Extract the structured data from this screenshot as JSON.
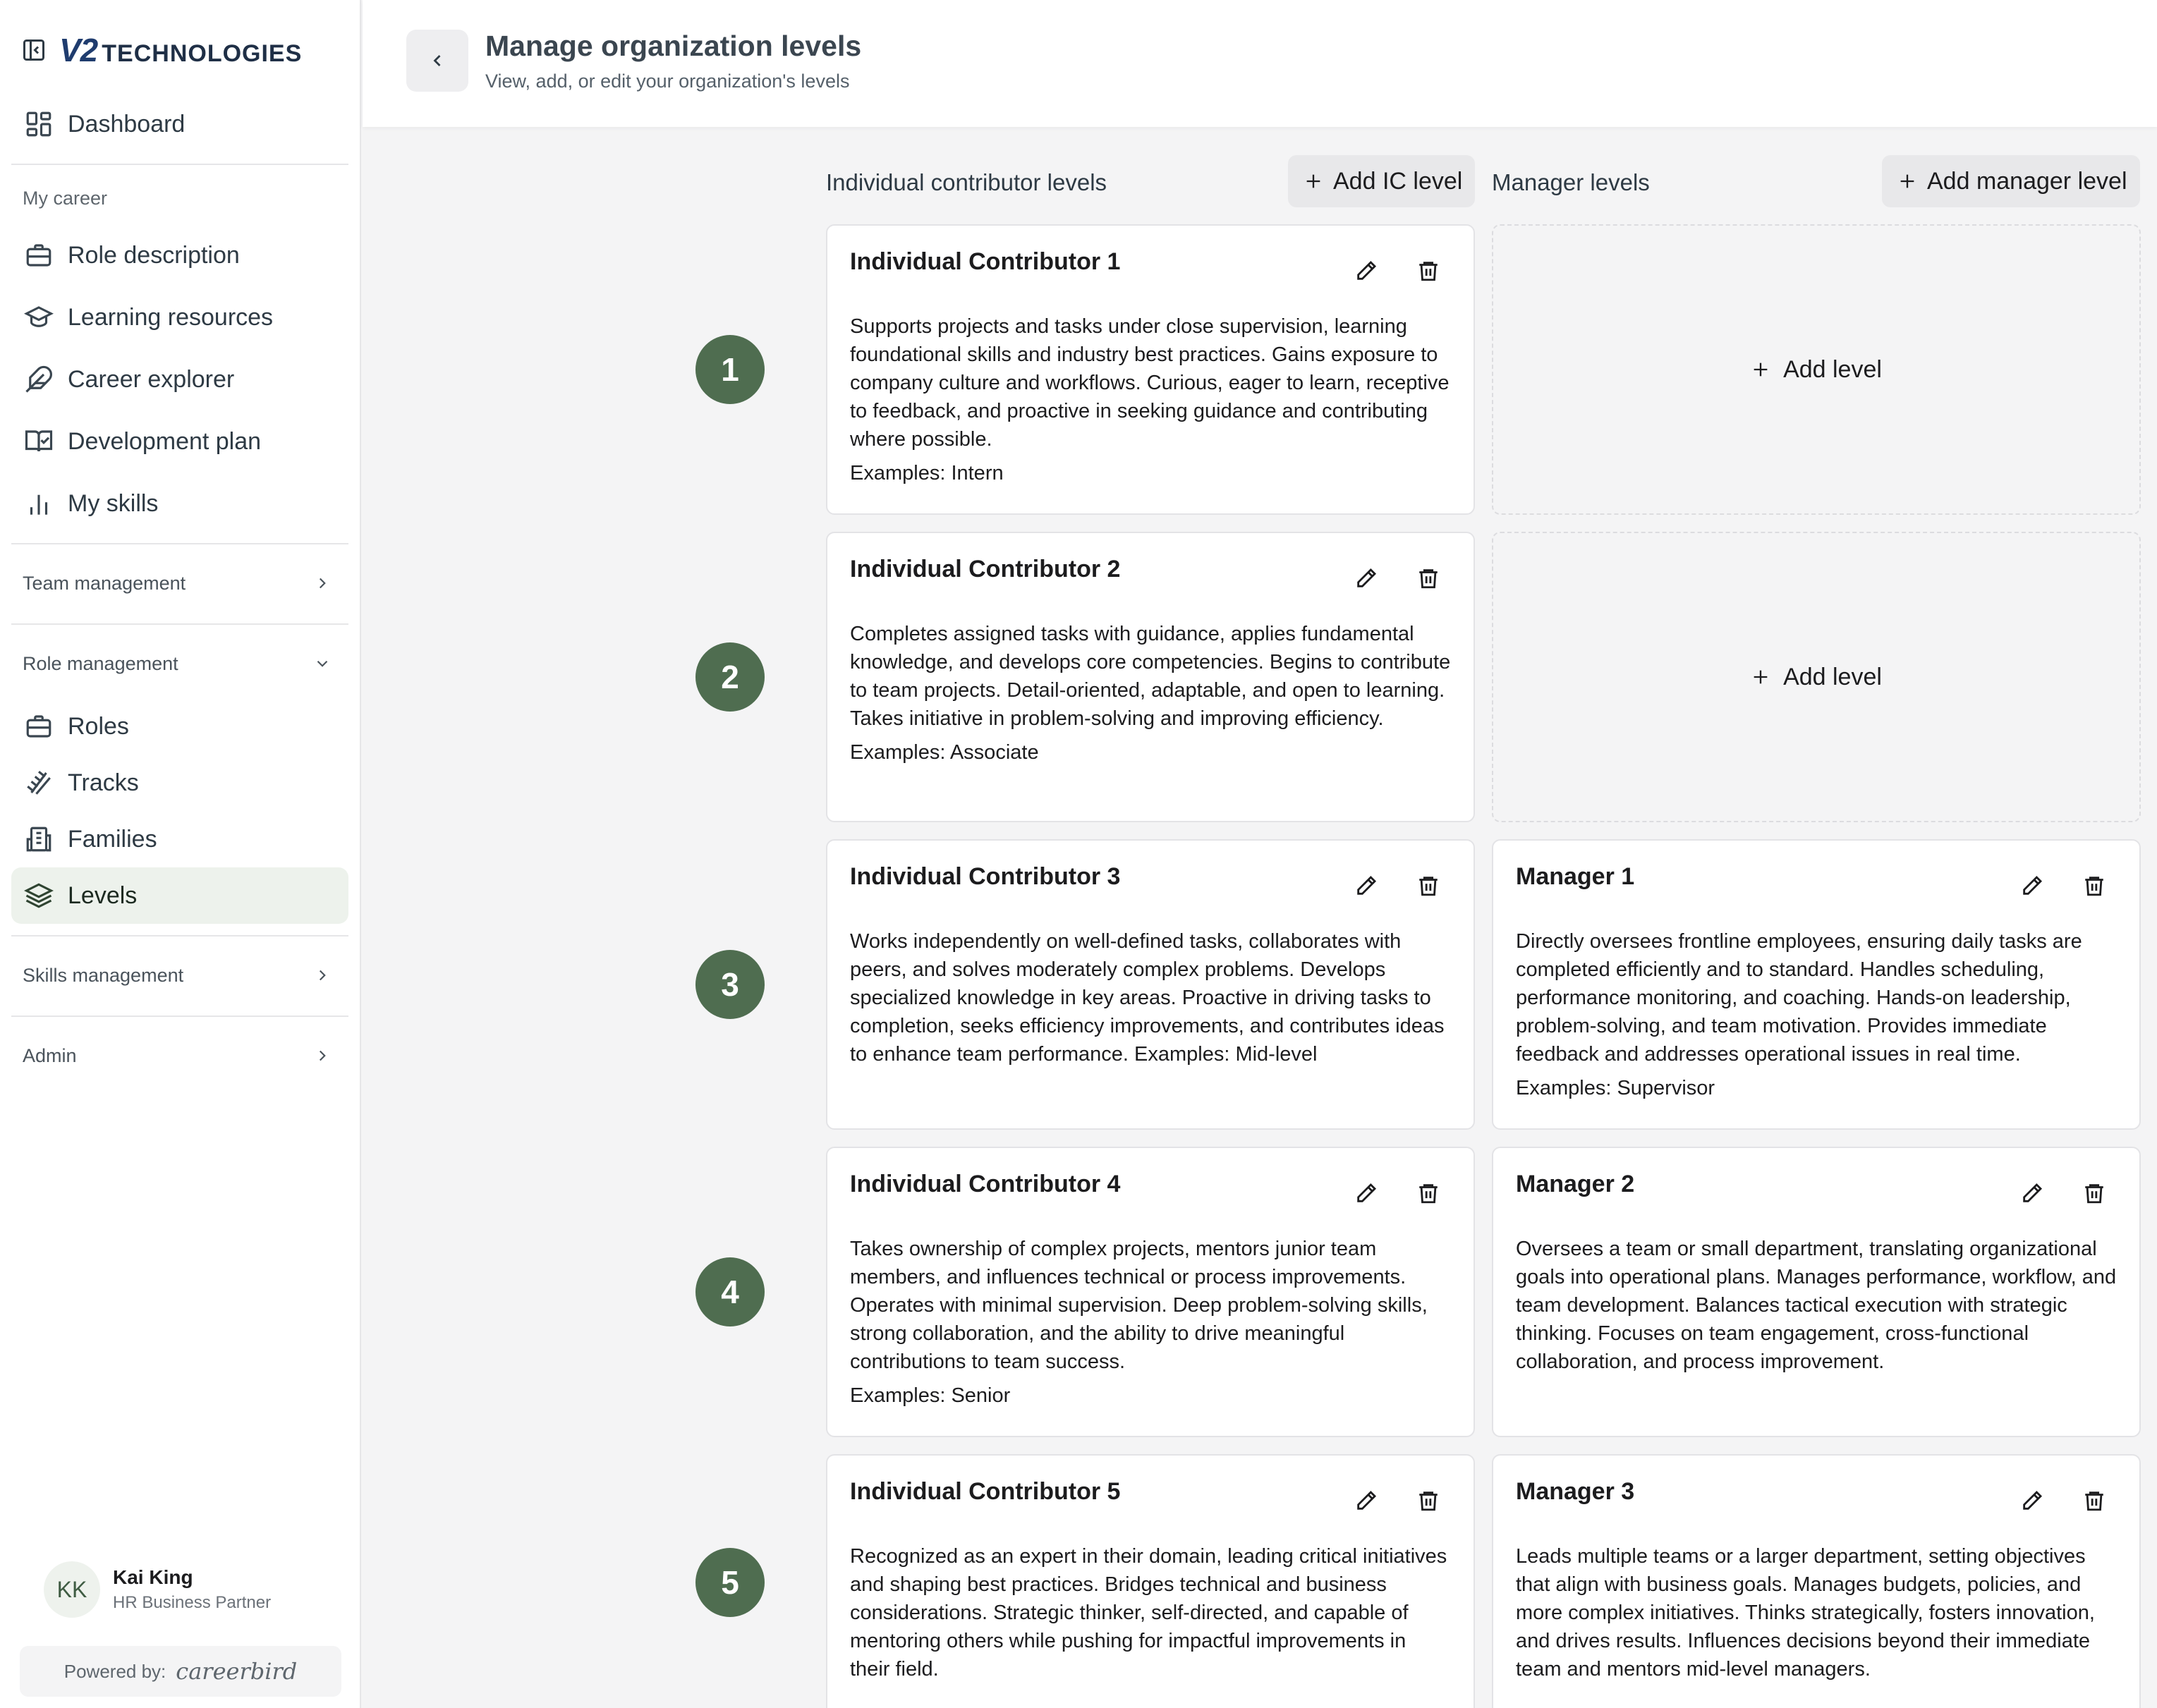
{
  "brand": {
    "name": "TECHNOLOGIES",
    "mark": "V2"
  },
  "sidebar": {
    "dashboard": "Dashboard",
    "my_career_label": "My career",
    "my_career": [
      {
        "label": "Role description",
        "icon": "briefcase-icon"
      },
      {
        "label": "Learning resources",
        "icon": "graduation-cap-icon"
      },
      {
        "label": "Career explorer",
        "icon": "feather-icon"
      },
      {
        "label": "Development plan",
        "icon": "book-check-icon"
      },
      {
        "label": "My skills",
        "icon": "bar-chart-icon"
      }
    ],
    "team_management": "Team management",
    "role_management": "Role management",
    "role_items": [
      {
        "label": "Roles",
        "icon": "briefcase-icon"
      },
      {
        "label": "Tracks",
        "icon": "railway-track-icon"
      },
      {
        "label": "Families",
        "icon": "building-icon"
      },
      {
        "label": "Levels",
        "icon": "layers-icon",
        "active": true
      }
    ],
    "skills_management": "Skills management",
    "admin": "Admin"
  },
  "user": {
    "initials": "KK",
    "name": "Kai King",
    "title": "HR Business Partner"
  },
  "powered": {
    "label": "Powered by:",
    "brand": "careerbird"
  },
  "header": {
    "title": "Manage organization levels",
    "subtitle": "View, add, or edit your organization's levels"
  },
  "board": {
    "ic_title": "Individual contributor levels",
    "ic_add": "Add IC level",
    "mgr_title": "Manager levels",
    "mgr_add": "Add manager level",
    "add_level": "Add level",
    "levels": [
      "1",
      "2",
      "3",
      "4",
      "5"
    ],
    "ic_cards": [
      {
        "title": "Individual Contributor 1",
        "desc": "Supports projects and tasks under close supervision, learning foundational skills and industry best practices. Gains exposure to company culture and workflows. Curious, eager to learn, receptive to feedback, and proactive in seeking guidance and contributing where possible.",
        "examples": "Examples: Intern"
      },
      {
        "title": "Individual Contributor 2",
        "desc": "Completes assigned tasks with guidance, applies fundamental knowledge, and develops core competencies. Begins to contribute to team projects. Detail-oriented, adaptable, and open to learning. Takes initiative in problem-solving and improving efficiency.",
        "examples": "Examples: Associate"
      },
      {
        "title": "Individual Contributor 3",
        "desc": "Works independently on well-defined tasks, collaborates with peers, and solves moderately complex problems. Develops specialized knowledge in key areas. Proactive in driving tasks to completion, seeks efficiency improvements, and contributes ideas to enhance team performance. Examples: Mid-level",
        "examples": ""
      },
      {
        "title": "Individual Contributor 4",
        "desc": "Takes ownership of complex projects, mentors junior team members, and influences technical or process improvements. Operates with minimal supervision. Deep problem-solving skills, strong collaboration, and the ability to drive meaningful contributions to team success.",
        "examples": "Examples: Senior"
      },
      {
        "title": "Individual Contributor 5",
        "desc": "Recognized as an expert in their domain, leading critical initiatives and shaping best practices. Bridges technical and business considerations. Strategic thinker, self-directed, and capable of mentoring others while pushing for impactful improvements in their field.",
        "examples": ""
      }
    ],
    "mgr_cards": [
      {
        "title": "Manager 1",
        "desc": "Directly oversees frontline employees, ensuring daily tasks are completed efficiently and to standard. Handles scheduling, performance monitoring, and coaching. Hands-on leadership, problem-solving, and team motivation. Provides immediate feedback and addresses operational issues in real time.",
        "examples": "Examples: Supervisor"
      },
      {
        "title": "Manager 2",
        "desc": "Oversees a team or small department, translating organizational goals into operational plans. Manages performance, workflow, and team development. Balances tactical execution with strategic thinking. Focuses on team engagement, cross-functional collaboration, and process improvement.",
        "examples": ""
      },
      {
        "title": "Manager 3",
        "desc": "Leads multiple teams or a larger department, setting objectives that align with business goals. Manages budgets, policies, and more complex initiatives. Thinks strategically, fosters innovation, and drives results. Influences decisions beyond their immediate team and mentors mid-level managers.",
        "examples": ""
      }
    ]
  },
  "colors": {
    "accent": "#4f6d50",
    "active_bg": "#edf2ec",
    "brand": "#1f3c6e"
  }
}
